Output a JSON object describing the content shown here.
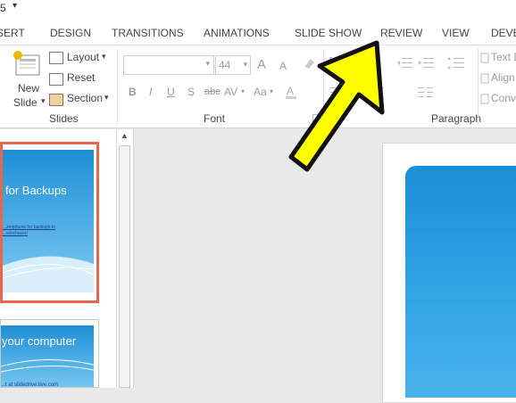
{
  "title_bar": {
    "qat_glyph": "5"
  },
  "tabs": [
    "SERT",
    "DESIGN",
    "TRANSITIONS",
    "ANIMATIONS",
    "SLIDE SHOW",
    "REVIEW",
    "VIEW",
    "DEVE"
  ],
  "ribbon": {
    "new_slide": {
      "line1": "New",
      "line2": "Slide"
    },
    "layout": "Layout",
    "reset": "Reset",
    "section": "Section",
    "groups": {
      "slides": "Slides",
      "font": "Font",
      "paragraph": "Paragraph"
    },
    "font_size": "44",
    "font_buttons": {
      "bold": "B",
      "italic": "I",
      "underline": "U",
      "shadow": "S",
      "strike": "abc",
      "spacing": "AV",
      "case": "Aa",
      "grow": "A",
      "shrink": "A"
    },
    "right_items": [
      "Text D",
      "Align",
      "Conv"
    ]
  },
  "thumbnails": [
    {
      "title": "for Backups",
      "caption_line1": "...zenphone for backups to",
      "caption_line2": "...whichever/"
    },
    {
      "title": "your computer",
      "caption_line1": "...t at slidedrive.live.com"
    }
  ],
  "colors": {
    "accent_arrow": "#ffff00",
    "slide_blue": "#1a8fd8",
    "selected_border": "#e8674a"
  }
}
